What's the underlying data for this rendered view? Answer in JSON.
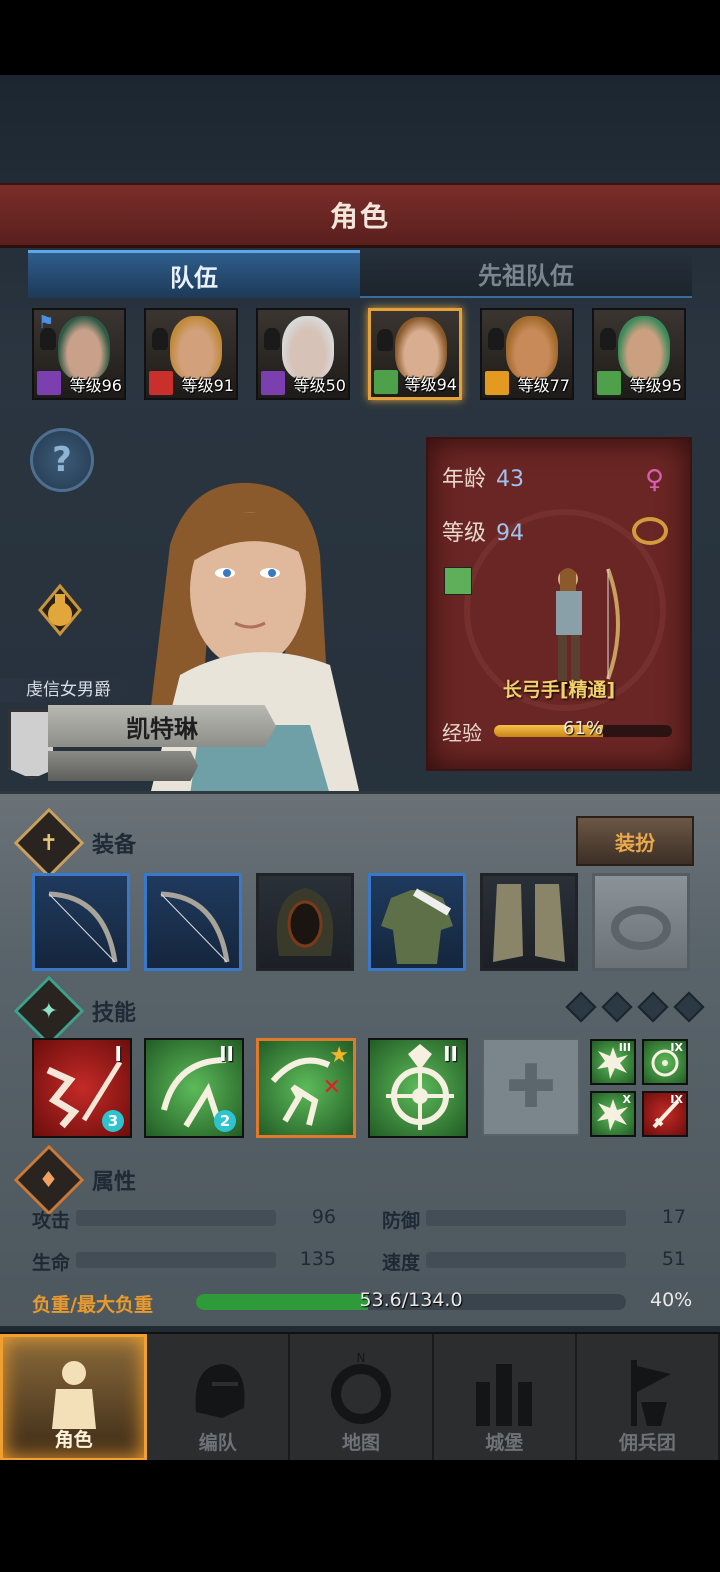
{
  "header": {
    "title": "角色"
  },
  "tabs": [
    {
      "label": "队伍",
      "active": true
    },
    {
      "label": "先祖队伍",
      "active": false
    }
  ],
  "party": [
    {
      "level_text": "等级96",
      "class_color": "#7b3fb0",
      "hair": "#2f5a45",
      "skin": "#c9a08a"
    },
    {
      "level_text": "等级91",
      "class_color": "#c9302c",
      "hair": "#c08a3a",
      "skin": "#d2a07a"
    },
    {
      "level_text": "等级50",
      "class_color": "#7b3fb0",
      "hair": "#d8d8d8",
      "skin": "#d6c2b6"
    },
    {
      "level_text": "等级94",
      "class_color": "#4fa04a",
      "hair": "#8a5a2a",
      "skin": "#d9ae90",
      "selected": true
    },
    {
      "level_text": "等级77",
      "class_color": "#e39a1e",
      "hair": "#a06a2a",
      "skin": "#c98a5a"
    },
    {
      "level_text": "等级95",
      "class_color": "#4fa04a",
      "hair": "#3c8a5a",
      "skin": "#caa080"
    }
  ],
  "hero": {
    "rank": "虔信女男爵",
    "name": "凯特琳",
    "info": {
      "age_label": "年龄",
      "age": "43",
      "level_label": "等级",
      "level": "94",
      "class_name": "长弓手[精通]",
      "exp_label": "经验",
      "exp_text": "61%",
      "exp_fraction": 0.61
    }
  },
  "equipment": {
    "title": "装备",
    "dress_button": "装扮",
    "slots": [
      "longbow-icon",
      "longbow-icon",
      "hood-icon",
      "tunic-icon",
      "boots-icon",
      "ring-icon"
    ]
  },
  "skills": {
    "title": "技能",
    "list": [
      {
        "icon": "shoot-arrow-icon",
        "color": "red",
        "rank": "I",
        "count": "3"
      },
      {
        "icon": "volley-icon",
        "color": "green",
        "rank": "II",
        "count": "2"
      },
      {
        "icon": "pierce-shot-icon",
        "color": "green",
        "star": true
      },
      {
        "icon": "target-icon",
        "color": "green",
        "rank": "II"
      }
    ],
    "passives": [
      {
        "icon": "burst-icon",
        "color": "green",
        "rank": "III"
      },
      {
        "icon": "crosshair-icon",
        "color": "green",
        "rank": "IX"
      },
      {
        "icon": "burst-icon",
        "color": "green",
        "rank": "X"
      },
      {
        "icon": "sword-icon",
        "color": "red",
        "rank": "IX"
      }
    ]
  },
  "attributes": {
    "title": "属性",
    "stats": [
      {
        "label": "攻击",
        "value": "96"
      },
      {
        "label": "防御",
        "value": "17"
      },
      {
        "label": "生命",
        "value": "135"
      },
      {
        "label": "速度",
        "value": "51"
      }
    ],
    "weight_label": "负重/最大负重",
    "weight_text": "53.6/134.0",
    "weight_fraction": 0.4,
    "weight_pct": "40%"
  },
  "nav": [
    {
      "label": "角色",
      "active": true,
      "icon": "knight-icon"
    },
    {
      "label": "编队",
      "active": false,
      "icon": "helmet-icon"
    },
    {
      "label": "地图",
      "active": false,
      "icon": "compass-map-icon"
    },
    {
      "label": "城堡",
      "active": false,
      "icon": "castle-icon"
    },
    {
      "label": "佣兵团",
      "active": false,
      "icon": "mercenary-banner-icon"
    }
  ]
}
